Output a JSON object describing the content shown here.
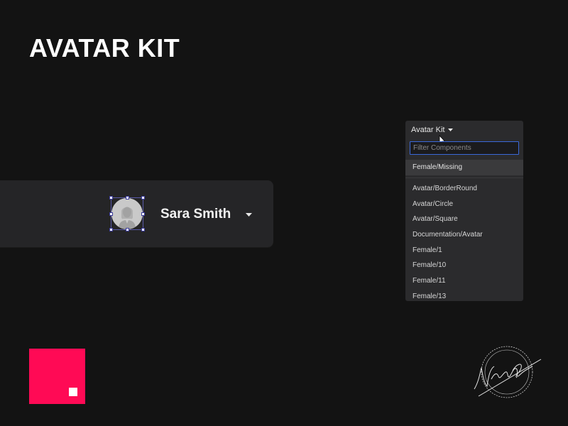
{
  "page": {
    "title": "AVATAR KIT"
  },
  "user_card": {
    "name": "Sara Smith",
    "avatar_icon": "person-silhouette-icon",
    "menu_icon": "caret-down-icon"
  },
  "component_panel": {
    "header": "Avatar Kit",
    "header_icon": "caret-down-icon",
    "filter": {
      "value": "",
      "placeholder": "Filter Components"
    },
    "selected_item": "Female/Missing",
    "items": [
      "Avatar/BorderRound",
      "Avatar/Circle",
      "Avatar/Square",
      "Documentation/Avatar",
      "Female/1",
      "Female/10",
      "Female/11",
      "Female/13"
    ]
  },
  "colors": {
    "background": "#131313",
    "card": "#252527",
    "panel": "#2b2b2d",
    "accent": "#ff0a55",
    "focus": "#3a68d8"
  }
}
